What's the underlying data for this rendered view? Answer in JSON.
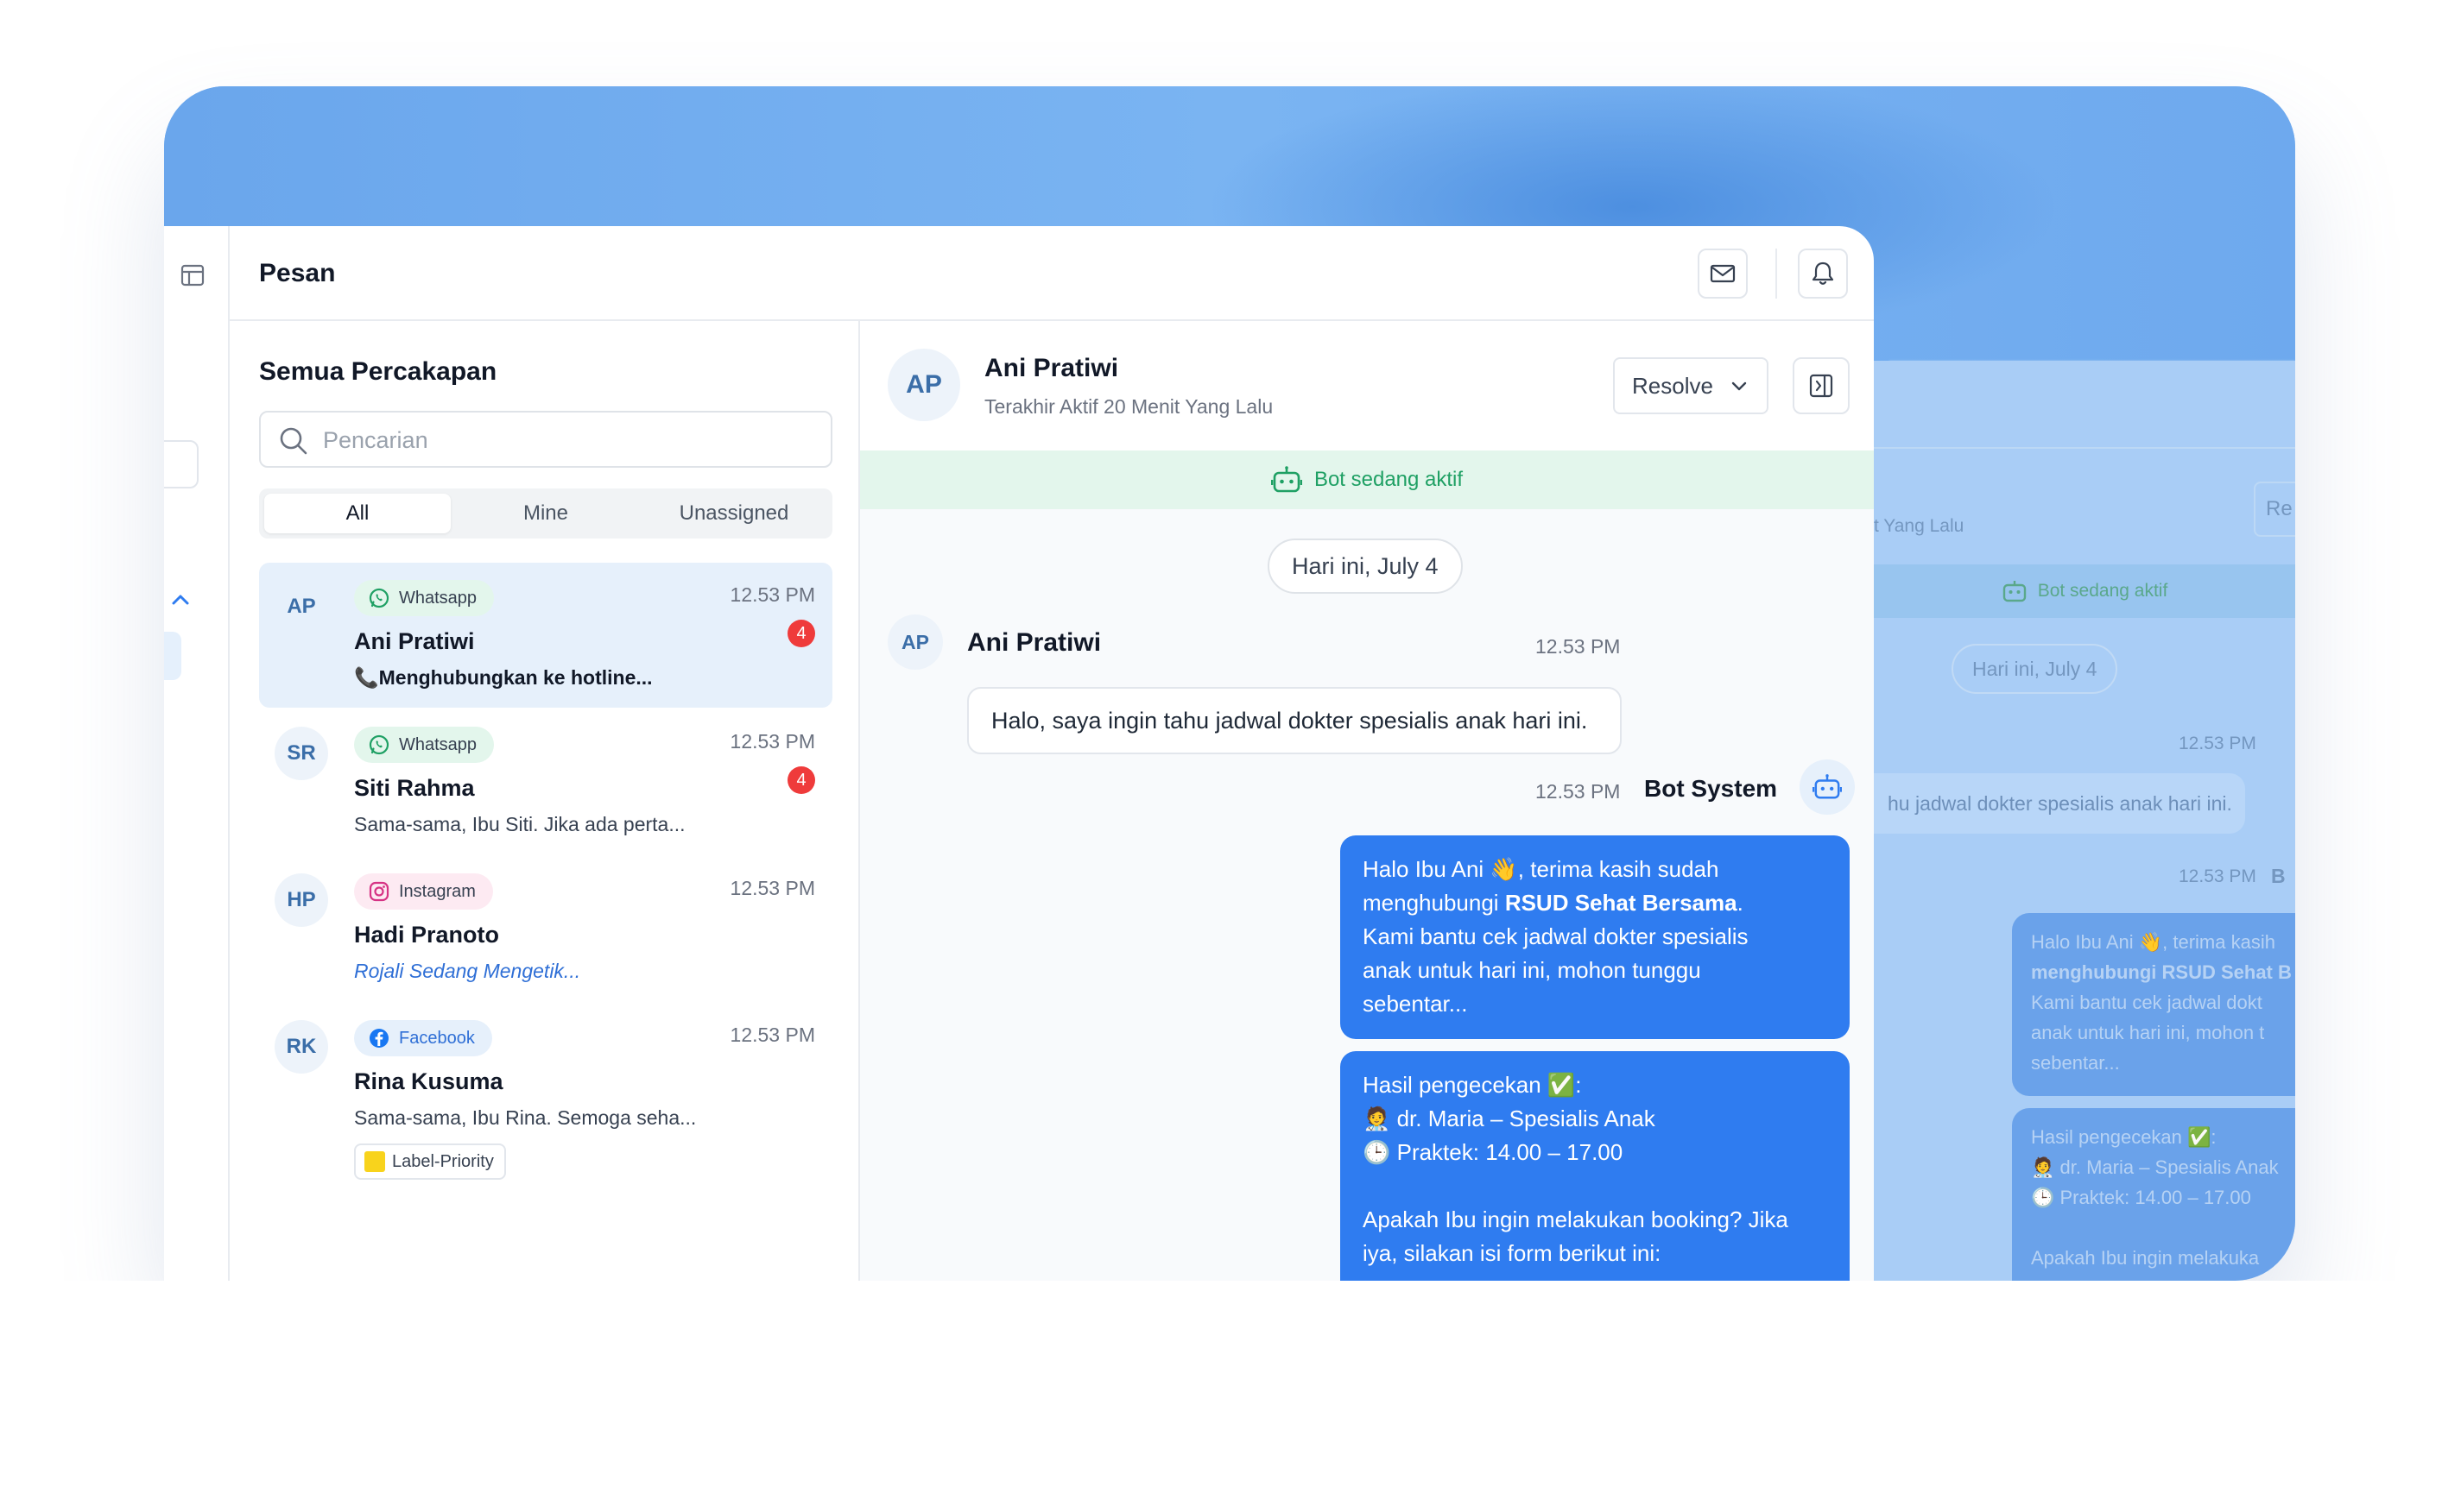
{
  "app": {
    "title": "Pesan"
  },
  "list": {
    "heading": "Semua Percakapan",
    "search_placeholder": "Pencarian",
    "tabs": [
      {
        "label": "All"
      },
      {
        "label": "Mine"
      },
      {
        "label": "Unassigned"
      }
    ],
    "conversations": [
      {
        "initials": "AP",
        "channel": "Whatsapp",
        "name": "Ani Pratiwi",
        "preview": "📞Menghubungkan ke hotline...",
        "time": "12.53 PM",
        "badge": "4"
      },
      {
        "initials": "SR",
        "channel": "Whatsapp",
        "name": "Siti Rahma",
        "preview": "Sama-sama, Ibu Siti. Jika ada perta...",
        "time": "12.53 PM",
        "badge": "4"
      },
      {
        "initials": "HP",
        "channel": "Instagram",
        "name": "Hadi Pranoto",
        "preview": "Rojali Sedang Mengetik...",
        "time": "12.53 PM"
      },
      {
        "initials": "RK",
        "channel": "Facebook",
        "name": "Rina Kusuma",
        "preview": "Sama-sama, Ibu Rina. Semoga seha...",
        "time": "12.53 PM",
        "label": "Label-Priority"
      }
    ]
  },
  "chat": {
    "initials": "AP",
    "name": "Ani Pratiwi",
    "status": "Terakhir Aktif 20 Menit Yang Lalu",
    "resolve_label": "Resolve",
    "bot_banner": "Bot sedang aktif",
    "day_label": "Hari ini, July 4",
    "incoming": {
      "initials": "AP",
      "sender": "Ani Pratiwi",
      "time": "12.53 PM",
      "text": "Halo, saya ingin tahu jadwal dokter spesialis anak hari ini."
    },
    "bot": {
      "sender": "Bot System",
      "time": "12.53 PM",
      "msg1": {
        "l1": "Halo Ibu Ani 👋, terima kasih sudah",
        "l2_pre": "menghubungi ",
        "l2_bold": "RSUD Sehat Bersama",
        "l2_post": ".",
        "l3": "Kami bantu cek jadwal dokter spesialis",
        "l4": "anak untuk hari ini, mohon tunggu",
        "l5": "sebentar..."
      },
      "msg2": {
        "l1": "Hasil pengecekan ✅:",
        "l2": "🧑‍⚕️ dr. Maria – Spesialis Anak",
        "l3": "🕒 Praktek: 14.00 – 17.00",
        "l5": "Apakah Ibu ingin melakukan booking? Jika",
        "l6": "iya, silakan isi form berikut ini:"
      }
    }
  },
  "ghost": {
    "status_fragment": "t Yang Lalu",
    "resolve_fragment": "Re",
    "bot_banner": "Bot sedang aktif",
    "day_label": "Hari ini, July 4",
    "time1": "12.53 PM",
    "incoming_fragment": "hu jadwal dokter spesialis anak hari ini.",
    "time2": "12.53 PM",
    "sender_fragment": "B",
    "b1": [
      "Halo Ibu Ani 👋, terima kasih",
      "menghubungi RSUD Sehat B",
      "Kami bantu cek jadwal dokt",
      "anak untuk hari ini, mohon t",
      "sebentar..."
    ],
    "b2": [
      "Hasil pengecekan ✅:",
      "🧑‍⚕️ dr. Maria – Spesialis Anak",
      "🕒 Praktek: 14.00 – 17.00",
      "",
      "Apakah Ibu ingin melakuka"
    ]
  },
  "colors": {
    "brand_blue": "#2f7cf0",
    "bot_green": "#1fa064",
    "badge_red": "#ef3b3b",
    "hero_blue": "#6aa6ec"
  }
}
